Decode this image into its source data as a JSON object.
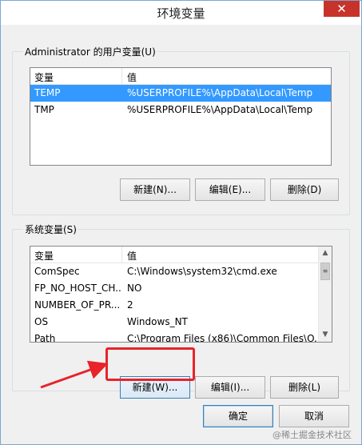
{
  "window": {
    "title": "环境变量",
    "close_glyph": "✕"
  },
  "user_vars": {
    "group_label": "Administrator 的用户变量(U)",
    "col_var": "变量",
    "col_val": "值",
    "rows": [
      {
        "name": "TEMP",
        "value": "%USERPROFILE%\\AppData\\Local\\Temp",
        "selected": true
      },
      {
        "name": "TMP",
        "value": "%USERPROFILE%\\AppData\\Local\\Temp",
        "selected": false
      }
    ],
    "new_label": "新建(N)...",
    "edit_label": "编辑(E)...",
    "delete_label": "删除(D)"
  },
  "system_vars": {
    "group_label": "系统变量(S)",
    "col_var": "变量",
    "col_val": "值",
    "rows": [
      {
        "name": "ComSpec",
        "value": "C:\\Windows\\system32\\cmd.exe"
      },
      {
        "name": "FP_NO_HOST_CH...",
        "value": "NO"
      },
      {
        "name": "NUMBER_OF_PR...",
        "value": "2"
      },
      {
        "name": "OS",
        "value": "Windows_NT"
      },
      {
        "name": "Path",
        "value": "C:\\Program Files (x86)\\Common Files\\O..."
      }
    ],
    "new_label": "新建(W)...",
    "edit_label": "编辑(I)...",
    "delete_label": "删除(L)"
  },
  "dialog": {
    "ok_label": "确定",
    "cancel_label": "取消"
  },
  "watermark": "@稀土掘金技术社区",
  "colors": {
    "selection": "#3399ff",
    "annotation": "#e8232a",
    "close_button": "#c7332b"
  }
}
